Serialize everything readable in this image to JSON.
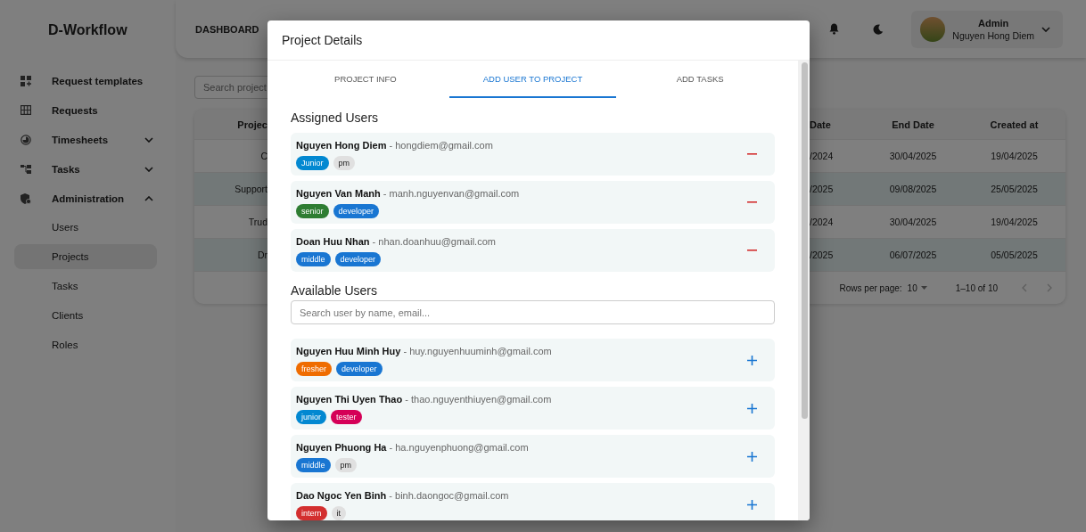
{
  "sidebar": {
    "brand": "D-Workflow",
    "items": [
      {
        "label": "Request templates"
      },
      {
        "label": "Requests"
      },
      {
        "label": "Timesheets",
        "expanded": false
      },
      {
        "label": "Tasks",
        "expanded": false
      },
      {
        "label": "Administration",
        "expanded": true,
        "children": [
          {
            "label": "Users",
            "selected": false
          },
          {
            "label": "Projects",
            "selected": true
          },
          {
            "label": "Tasks",
            "selected": false
          },
          {
            "label": "Clients",
            "selected": false
          },
          {
            "label": "Roles",
            "selected": false
          }
        ]
      }
    ]
  },
  "header": {
    "title": "DASHBOARD",
    "user": {
      "role": "Admin",
      "name": "Nguyen Hong Diem"
    }
  },
  "search": {
    "placeholder": "Search project"
  },
  "table": {
    "columns": [
      "Projec",
      "Date",
      "End Date",
      "Created at"
    ],
    "rows": [
      [
        "C",
        "/2024",
        "30/04/2025",
        "19/04/2025"
      ],
      [
        "Support",
        "/2025",
        "09/08/2025",
        "25/05/2025"
      ],
      [
        "Trud",
        "/2024",
        "30/04/2025",
        "19/04/2025"
      ],
      [
        "Dr",
        "/2025",
        "06/07/2025",
        "05/05/2025"
      ]
    ],
    "pagination": {
      "rows_label": "Rows per page:",
      "rows_value": "10",
      "range": "1–10 of 10"
    }
  },
  "modal": {
    "title": "Project Details",
    "name_separator": "-",
    "tabs": [
      {
        "label": "PROJECT INFO",
        "selected": false
      },
      {
        "label": "ADD USER TO PROJECT",
        "selected": true
      },
      {
        "label": "ADD TASKS",
        "selected": false
      }
    ],
    "assigned": {
      "title": "Assigned Users",
      "users": [
        {
          "name": "Nguyen Hong Diem",
          "email": "hongdiem@gmail.com",
          "tags": [
            {
              "label": "Junior",
              "color": "#0288d1"
            },
            {
              "label": "pm",
              "color": "#e0e0e0"
            }
          ]
        },
        {
          "name": "Nguyen Van Manh",
          "email": "manh.nguyenvan@gmail.com",
          "tags": [
            {
              "label": "senior",
              "color": "#2e7d32"
            },
            {
              "label": "developer",
              "color": "#1976d2"
            }
          ]
        },
        {
          "name": "Doan Huu Nhan",
          "email": "nhan.doanhuu@gmail.com",
          "tags": [
            {
              "label": "middle",
              "color": "#1976d2"
            },
            {
              "label": "developer",
              "color": "#1976d2"
            }
          ]
        }
      ]
    },
    "available": {
      "title": "Available Users",
      "search": {
        "placeholder": "Search user by name, email..."
      },
      "users": [
        {
          "name": "Nguyen Huu Minh Huy",
          "email": "huy.nguyenhuuminh@gmail.com",
          "tags": [
            {
              "label": "fresher",
              "color": "#ef6c00"
            },
            {
              "label": "developer",
              "color": "#1976d2"
            }
          ]
        },
        {
          "name": "Nguyen Thi Uyen Thao",
          "email": "thao.nguyenthiuyen@gmail.com",
          "tags": [
            {
              "label": "junior",
              "color": "#0288d1"
            },
            {
              "label": "tester",
              "color": "#d50057"
            }
          ]
        },
        {
          "name": "Nguyen Phuong Ha",
          "email": "ha.nguyenphuong@gmail.com",
          "tags": [
            {
              "label": "middle",
              "color": "#1976d2"
            },
            {
              "label": "pm",
              "color": "#e0e0e0"
            }
          ]
        },
        {
          "name": "Dao Ngoc Yen Binh",
          "email": "binh.daongoc@gmail.com",
          "tags": [
            {
              "label": "intern",
              "color": "#d32f2f"
            },
            {
              "label": "it",
              "color": "#e0e0e0"
            }
          ]
        }
      ]
    }
  }
}
